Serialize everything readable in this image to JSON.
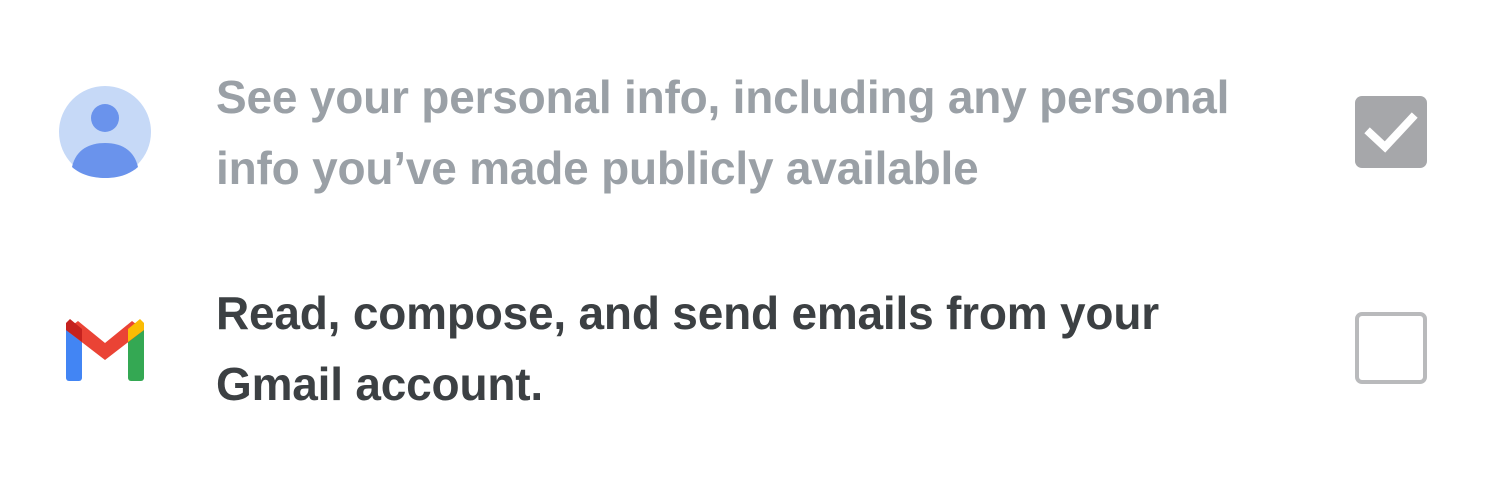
{
  "permissions": [
    {
      "icon": "account-avatar-icon",
      "lines": [
        "See your personal info, including any personal",
        "info you’ve made publicly available"
      ],
      "checked": true,
      "state": "disabled"
    },
    {
      "icon": "gmail-icon",
      "lines": [
        "Read, compose, and send emails from your",
        "Gmail account."
      ],
      "checked": false,
      "state": "enabled"
    }
  ],
  "colors": {
    "disabled_text": "#9aa0a6",
    "active_text": "#3c4043",
    "checkbox_checked_bg": "#a6a7aa",
    "checkbox_border": "#b9babc",
    "avatar_bg": "#c6d9f7",
    "avatar_fg": "#6a93ec",
    "gmail_blue": "#4285f4",
    "gmail_red": "#ea4335",
    "gmail_yellow": "#fbbc04",
    "gmail_green": "#34a853",
    "gmail_dark_red": "#c5221f"
  }
}
